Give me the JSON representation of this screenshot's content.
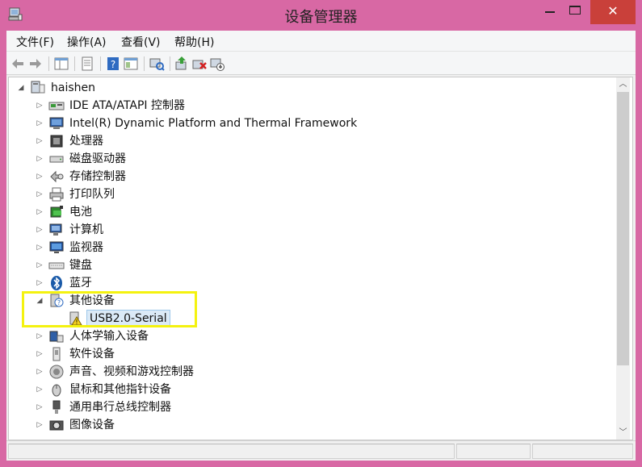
{
  "window": {
    "title": "设备管理器",
    "close_label": "✕",
    "accent": "#d868a4",
    "close_color": "#c9403a"
  },
  "menu": [
    {
      "label": "文件(F)"
    },
    {
      "label": "操作(A)"
    },
    {
      "label": "查看(V)"
    },
    {
      "label": "帮助(H)"
    }
  ],
  "toolbar": [
    {
      "icon": "back-arrow-icon"
    },
    {
      "icon": "forward-arrow-icon"
    },
    {
      "icon": "show-hide-tree-icon"
    },
    {
      "icon": "properties-icon"
    },
    {
      "icon": "help-icon"
    },
    {
      "icon": "view-details-icon"
    },
    {
      "icon": "scan-hardware-icon"
    },
    {
      "icon": "update-driver-icon"
    },
    {
      "icon": "uninstall-icon"
    },
    {
      "icon": "disable-device-icon"
    }
  ],
  "tree": {
    "root": {
      "label": "haishen",
      "icon": "computer-icon",
      "expanded": true
    },
    "categories": [
      {
        "label": "IDE ATA/ATAPI 控制器",
        "icon": "ide-controller-icon"
      },
      {
        "label": "Intel(R) Dynamic Platform and Thermal Framework",
        "icon": "intel-thermal-icon"
      },
      {
        "label": "处理器",
        "icon": "processor-icon"
      },
      {
        "label": "磁盘驱动器",
        "icon": "disk-drive-icon"
      },
      {
        "label": "存储控制器",
        "icon": "storage-controller-icon"
      },
      {
        "label": "打印队列",
        "icon": "printer-icon"
      },
      {
        "label": "电池",
        "icon": "battery-icon"
      },
      {
        "label": "计算机",
        "icon": "computer-category-icon"
      },
      {
        "label": "监视器",
        "icon": "monitor-icon"
      },
      {
        "label": "键盘",
        "icon": "keyboard-icon"
      },
      {
        "label": "蓝牙",
        "icon": "bluetooth-icon"
      },
      {
        "label": "其他设备",
        "icon": "other-devices-icon",
        "expanded": true,
        "children": [
          {
            "label": "USB2.0-Serial",
            "icon": "warning-device-icon",
            "selected": true
          }
        ]
      },
      {
        "label": "人体学输入设备",
        "icon": "hid-icon"
      },
      {
        "label": "软件设备",
        "icon": "software-device-icon"
      },
      {
        "label": "声音、视频和游戏控制器",
        "icon": "sound-icon"
      },
      {
        "label": "鼠标和其他指针设备",
        "icon": "mouse-icon"
      },
      {
        "label": "通用串行总线控制器",
        "icon": "usb-controller-icon"
      },
      {
        "label": "图像设备",
        "icon": "imaging-device-icon"
      }
    ]
  },
  "glyphs": {
    "expand": "▷",
    "collapse": "◢",
    "scroll_up": "︿",
    "scroll_down": "﹀"
  }
}
